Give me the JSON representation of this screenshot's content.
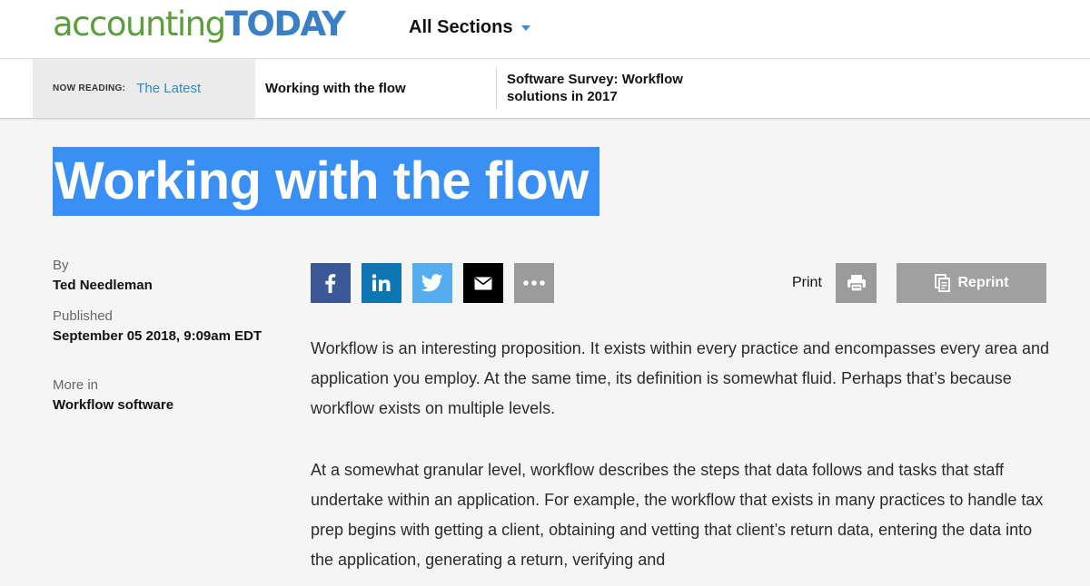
{
  "header": {
    "logo_part1": "accounting",
    "logo_part2": "TODAY",
    "all_sections": "All Sections"
  },
  "reading_bar": {
    "now_reading_label": "NOW READING:",
    "latest_link": "The Latest",
    "current_article": "Working with the flow",
    "next_article": "Software Survey: Workflow solutions in 2017"
  },
  "article": {
    "title": "Working with the flow",
    "by_label": "By",
    "author": "Ted Needleman",
    "published_label": "Published",
    "published_date": "September 05 2018, 9:09am EDT",
    "more_in_label": "More in",
    "more_in_value": "Workflow software",
    "paragraphs": [
      "Workflow is an interesting proposition. It exists within every practice and encompasses every area and application you employ. At the same time, its definition is somewhat fluid. Perhaps that’s because workflow exists on multiple levels.",
      "At a somewhat granular level, workflow describes the steps that data follows and tasks that staff undertake within an application. For example, the workflow that exists in many practices to handle tax prep begins with getting a client, obtaining and vetting that client’s return data, entering the data into the application, generating a return, verifying and"
    ]
  },
  "share": {
    "buttons": [
      {
        "icon": "facebook-icon",
        "color": "#3b5998"
      },
      {
        "icon": "linkedin-icon",
        "color": "#0e76b3"
      },
      {
        "icon": "twitter-icon",
        "color": "#55acee"
      },
      {
        "icon": "email-icon",
        "color": "#000000"
      },
      {
        "icon": "more-icon",
        "color": "#9b9b9b"
      }
    ],
    "print_label": "Print",
    "reprint_label": "Reprint"
  },
  "colors": {
    "title_highlight": "#3a8ff5",
    "link": "#2a8fc7",
    "logo_green": "#5a9e3c",
    "logo_blue": "#3b80c4"
  }
}
